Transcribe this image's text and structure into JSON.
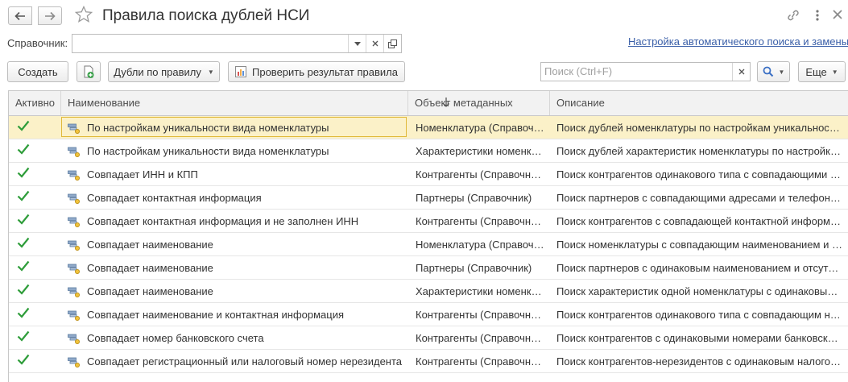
{
  "window": {
    "title": "Правила поиска дублей НСИ",
    "icons": [
      "arrow-left-icon",
      "arrow-right-icon",
      "star-icon",
      "link-icon",
      "more-vertical-icon",
      "close-icon"
    ]
  },
  "filter": {
    "catalog_label": "Справочник:",
    "catalog_value": "",
    "auto_search_link": "Настройка автоматического поиска и замены"
  },
  "toolbar": {
    "create_label": "Создать",
    "duplicates_by_rule_label": "Дубли по правилу",
    "check_rule_result_label": "Проверить результат правила",
    "search_placeholder": "Поиск (Ctrl+F)",
    "more_label": "Еще"
  },
  "table": {
    "columns": [
      "Активно",
      "Наименование",
      "Объект метаданных",
      "Описание"
    ],
    "sorted_column": "Наименование",
    "sort_direction": "descending",
    "selected_row": 0,
    "rows": [
      {
        "active": true,
        "name": "По настройкам уникальности вида номенклатуры",
        "object": "Номенклатура (Справочник)",
        "description": "Поиск дублей номенклатуры по настройкам уникальности вида номенклатуры"
      },
      {
        "active": true,
        "name": "По настройкам уникальности вида номенклатуры",
        "object": "Характеристики номенклатуры (Справочник)",
        "description": "Поиск дублей характеристик номенклатуры по настройкам уникальности"
      },
      {
        "active": true,
        "name": "Совпадает ИНН и КПП",
        "object": "Контрагенты (Справочник)",
        "description": "Поиск контрагентов одинакового типа с совпадающими ИНН и КПП"
      },
      {
        "active": true,
        "name": "Совпадает контактная информация",
        "object": "Партнеры (Справочник)",
        "description": "Поиск партнеров с совпадающими адресами и телефонами"
      },
      {
        "active": true,
        "name": "Совпадает контактная информация и не заполнен ИНН",
        "object": "Контрагенты (Справочник)",
        "description": "Поиск контрагентов с совпадающей контактной информацией"
      },
      {
        "active": true,
        "name": "Совпадает наименование",
        "object": "Номенклатура (Справочник)",
        "description": "Поиск номенклатуры с совпадающим наименованием и видом"
      },
      {
        "active": true,
        "name": "Совпадает наименование",
        "object": "Партнеры (Справочник)",
        "description": "Поиск партнеров с одинаковым наименованием и отсутствием ИНН"
      },
      {
        "active": true,
        "name": "Совпадает наименование",
        "object": "Характеристики номенклатуры (Справочник)",
        "description": "Поиск характеристик одной номенклатуры с одинаковым наименованием"
      },
      {
        "active": true,
        "name": "Совпадает наименование и контактная информация",
        "object": "Контрагенты (Справочник)",
        "description": "Поиск контрагентов одинакового типа с совпадающим наименованием"
      },
      {
        "active": true,
        "name": "Совпадает номер банковского счета",
        "object": "Контрагенты (Справочник)",
        "description": "Поиск контрагентов с одинаковыми номерами банковских счетов"
      },
      {
        "active": true,
        "name": "Совпадает регистрационный или налоговый номер нерезидента",
        "object": "Контрагенты (Справочник)",
        "description": "Поиск контрагентов-нерезидентов с одинаковым налоговым номером"
      }
    ]
  },
  "colors": {
    "accent_link": "#3a5fa8",
    "selected_row": "#fbf1c8",
    "check": "#2e9d3a"
  }
}
